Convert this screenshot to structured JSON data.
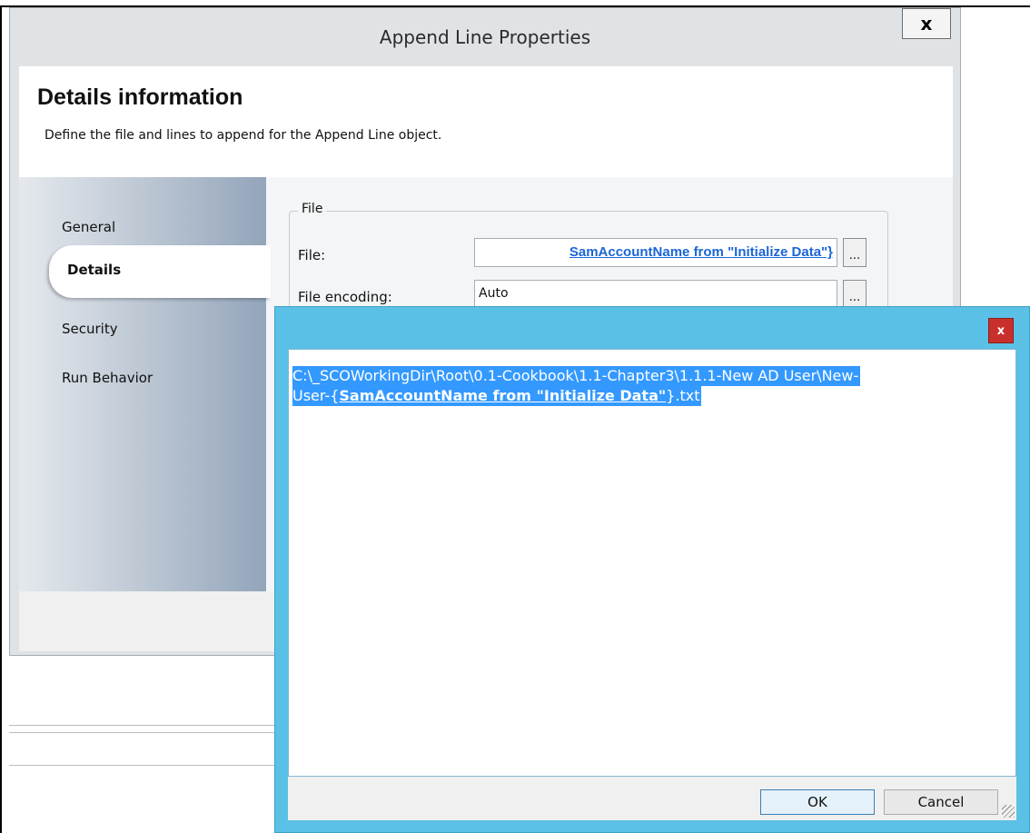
{
  "window": {
    "title": "Append Line Properties",
    "close_label": "x"
  },
  "header": {
    "title": "Details information",
    "subtitle": "Define the file and lines to append for the Append Line object."
  },
  "nav": {
    "items": [
      {
        "label": "General"
      },
      {
        "label": "Details",
        "selected": true
      },
      {
        "label": "Security"
      },
      {
        "label": "Run Behavior"
      }
    ]
  },
  "file_group": {
    "legend": "File",
    "file_label": "File:",
    "file_value": "SamAccountName from \"Initialize Data\"}",
    "encoding_label": "File encoding:",
    "encoding_value": "Auto",
    "browse_label": "..."
  },
  "popup": {
    "close_label": "x",
    "line1": "C:\\_SCOWorkingDir\\Root\\0.1-Cookbook\\1.1-Chapter3\\1.1.1-New AD User\\New-",
    "line2_prefix": "User-{",
    "line2_bold": "SamAccountName from \"Initialize Data\"",
    "line2_suffix": "}.txt",
    "ok_label": "OK",
    "cancel_label": "Cancel"
  },
  "colors": {
    "popup_border": "#5bc0e6",
    "selection": "#3399ff",
    "link": "#1a66d6",
    "close_red": "#c9302c"
  }
}
